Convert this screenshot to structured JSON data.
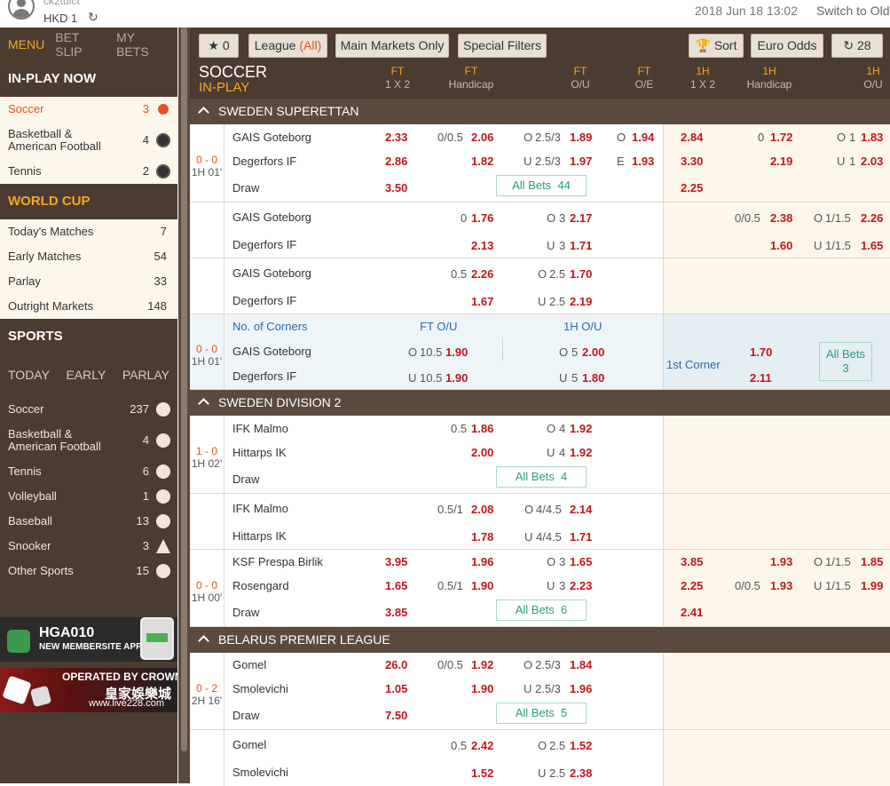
{
  "header": {
    "username": "ck2tuict",
    "balance": "HKD 1",
    "datetime": "2018 Jun 18 13:02",
    "switch": "Switch to Old"
  },
  "menu": {
    "tabs": [
      "MENU",
      "BET SLIP",
      "MY BETS"
    ]
  },
  "inplay": {
    "title": "IN-PLAY NOW",
    "items": [
      {
        "label": "Soccer",
        "count": "3"
      },
      {
        "label": "Basketball &",
        "label2": "American Football",
        "count": "4"
      },
      {
        "label": "Tennis",
        "count": "2"
      }
    ]
  },
  "worldcup": {
    "title": "WORLD CUP",
    "items": [
      {
        "label": "Today's Matches",
        "count": "7"
      },
      {
        "label": "Early Matches",
        "count": "54"
      },
      {
        "label": "Parlay",
        "count": "33"
      },
      {
        "label": "Outright Markets",
        "count": "148"
      }
    ]
  },
  "sports": {
    "title": "SPORTS",
    "tabs": [
      "TODAY",
      "EARLY",
      "PARLAY"
    ],
    "items": [
      {
        "label": "Soccer",
        "count": "237"
      },
      {
        "label": "Basketball &",
        "label2": "American Football",
        "count": "4"
      },
      {
        "label": "Tennis",
        "count": "6"
      },
      {
        "label": "Volleyball",
        "count": "1"
      },
      {
        "label": "Baseball",
        "count": "13"
      },
      {
        "label": "Snooker",
        "count": "3"
      },
      {
        "label": "Other Sports",
        "count": "15"
      }
    ]
  },
  "banners": {
    "b1_title": "HGA010",
    "b1_sub": "NEW MEMBERSITE APP",
    "b2_t1": "OPERATED BY CROWN",
    "b2_t2": "皇家娛樂城",
    "b2_t3": "www.live228.com"
  },
  "toolbar": {
    "fav_count": "0",
    "league": "League",
    "league_all": "(All)",
    "main_markets": "Main Markets Only",
    "special": "Special Filters",
    "sort": "Sort",
    "odds": "Euro Odds",
    "refresh": "28"
  },
  "columns": {
    "sport": "SOCCER",
    "status": "IN-PLAY",
    "h": [
      [
        "FT",
        "1 X 2"
      ],
      [
        "FT",
        "Handicap"
      ],
      [
        "FT",
        "O/U"
      ],
      [
        "FT",
        "O/E"
      ],
      [
        "1H",
        "1 X 2"
      ],
      [
        "1H",
        "Handicap"
      ],
      [
        "1H",
        "O/U"
      ]
    ]
  },
  "leagues": [
    "SWEDEN SUPERETTAN",
    "SWEDEN DIVISION 2",
    "BELARUS PREMIER LEAGUE"
  ],
  "m1": {
    "score": "0 - 0",
    "time": "1H 01'",
    "home": "GAIS Goteborg",
    "away": "Degerfors IF",
    "draw": "Draw",
    "r1": [
      "2.33",
      "0/0.5",
      "2.06",
      "O",
      "2.5/3",
      "1.89",
      "O",
      "1.94",
      "2.84",
      "0",
      "1.72",
      "O",
      "1",
      "1.83"
    ],
    "r2": [
      "2.86",
      "1.82",
      "U",
      "2.5/3",
      "1.97",
      "E",
      "1.93",
      "3.30",
      "2.19",
      "U",
      "1",
      "2.03"
    ],
    "r3": [
      "3.50",
      "2.25"
    ],
    "allbets": "All Bets",
    "allcount": "44",
    "b2": [
      "0",
      "1.76",
      "O",
      "3",
      "2.17",
      "0/0.5",
      "2.38",
      "O",
      "1/1.5",
      "2.26",
      "2.13",
      "U",
      "3",
      "1.71",
      "1.60",
      "U",
      "1/1.5",
      "1.65"
    ],
    "b3": [
      "0.5",
      "2.26",
      "O",
      "2.5",
      "1.70",
      "1.67",
      "U",
      "2.5",
      "2.19"
    ]
  },
  "corners": {
    "label": "No. of Corners",
    "ftou": "FT O/U",
    "htou": "1H O/U",
    "score": "0 - 0",
    "time": "1H 01'",
    "home": "GAIS Goteborg",
    "away": "Degerfors IF",
    "o1": "O",
    "l1": "10.5",
    "v1": "1.90",
    "o2": "O",
    "l2": "5",
    "v2": "2.00",
    "u1": "U",
    "l3": "10.5",
    "v3": "1.90",
    "u2": "U",
    "l4": "5",
    "v4": "1.80",
    "first": "1st Corner",
    "f1": "1.70",
    "f2": "2.11",
    "allbets": "All Bets",
    "allcount": "3"
  },
  "m2": {
    "score": "1 - 0",
    "time": "1H 02'",
    "home": "IFK Malmo",
    "away": "Hittarps IK",
    "draw": "Draw",
    "r1": [
      "0.5",
      "1.86",
      "O",
      "4",
      "1.92"
    ],
    "r2": [
      "2.00",
      "U",
      "4",
      "1.92"
    ],
    "allbets": "All Bets",
    "allcount": "4",
    "b2": [
      "0.5/1",
      "2.08",
      "O",
      "4/4.5",
      "2.14",
      "1.78",
      "U",
      "4/4.5",
      "1.71"
    ]
  },
  "m3": {
    "score": "0 - 0",
    "time": "1H 00'",
    "home": "KSF Prespa Birlik",
    "away": "Rosengard",
    "draw": "Draw",
    "r1": [
      "3.95",
      "1.96",
      "O",
      "3",
      "1.65",
      "3.85",
      "1.93",
      "O",
      "1/1.5",
      "1.85"
    ],
    "r2": [
      "1.65",
      "0.5/1",
      "1.90",
      "U",
      "3",
      "2.23",
      "2.25",
      "0/0.5",
      "1.93",
      "U",
      "1/1.5",
      "1.99"
    ],
    "r3": [
      "3.85",
      "2.41"
    ],
    "allbets": "All Bets",
    "allcount": "6"
  },
  "m4": {
    "score": "0 - 2",
    "time": "2H 16'",
    "home": "Gomel",
    "away": "Smolevichi",
    "draw": "Draw",
    "r1": [
      "26.0",
      "0/0.5",
      "1.92",
      "O",
      "2.5/3",
      "1.84"
    ],
    "r2": [
      "1.05",
      "1.90",
      "U",
      "2.5/3",
      "1.96"
    ],
    "r3": [
      "7.50"
    ],
    "allbets": "All Bets",
    "allcount": "5",
    "b2": [
      "0.5",
      "2.42",
      "O",
      "2.5",
      "1.52",
      "1.52",
      "U",
      "2.5",
      "2.38"
    ]
  }
}
